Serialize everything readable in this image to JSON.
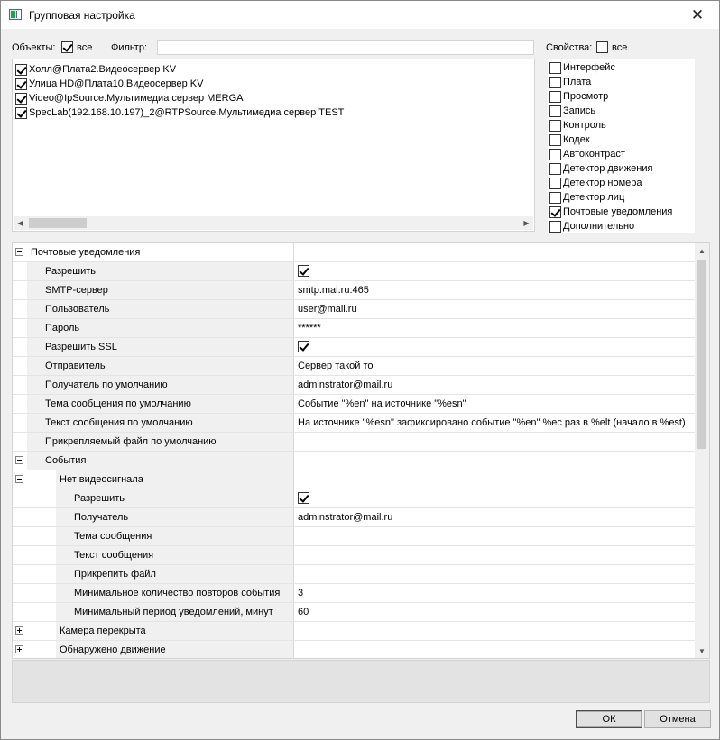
{
  "window": {
    "title": "Групповая настройка",
    "close_symbol": "✕"
  },
  "objects": {
    "label": "Объекты:",
    "all_label": "все",
    "all_checked": true,
    "filter_label": "Фильтр:",
    "filter_value": "",
    "items": [
      {
        "label": "Холл@Плата2.Видеосервер KV",
        "checked": true
      },
      {
        "label": "Улица HD@Плата10.Видеосервер KV",
        "checked": true
      },
      {
        "label": "Video@IpSource.Мультимедиа сервер MERGA",
        "checked": true
      },
      {
        "label": "SpecLab(192.168.10.197)_2@RTPSource.Мультимедиа сервер TEST",
        "checked": true
      }
    ],
    "scroll_left": "◀",
    "scroll_right": "▶"
  },
  "properties": {
    "label": "Свойства:",
    "all_label": "все",
    "all_checked": false,
    "items": [
      {
        "label": "Интерфейс",
        "checked": false
      },
      {
        "label": "Плата",
        "checked": false
      },
      {
        "label": "Просмотр",
        "checked": false
      },
      {
        "label": "Запись",
        "checked": false
      },
      {
        "label": "Контроль",
        "checked": false
      },
      {
        "label": "Кодек",
        "checked": false
      },
      {
        "label": "Автоконтраст",
        "checked": false
      },
      {
        "label": "Детектор движения",
        "checked": false
      },
      {
        "label": "Детектор номера",
        "checked": false
      },
      {
        "label": "Детектор лиц",
        "checked": false
      },
      {
        "label": "Почтовые уведомления",
        "checked": true
      },
      {
        "label": "Дополнительно",
        "checked": false
      }
    ]
  },
  "grid": {
    "rows": [
      {
        "name": "Почтовые уведомления",
        "value": "",
        "level": 0,
        "category": true,
        "expander": "minus"
      },
      {
        "name": "Разрешить",
        "value": "",
        "level": 1,
        "checkbox": true,
        "checked": true
      },
      {
        "name": "SMTP-сервер",
        "value": "smtp.mai.ru:465",
        "level": 1
      },
      {
        "name": "Пользователь",
        "value": "user@mail.ru",
        "level": 1
      },
      {
        "name": "Пароль",
        "value": "******",
        "level": 1
      },
      {
        "name": "Разрешить SSL",
        "value": "",
        "level": 1,
        "checkbox": true,
        "checked": true
      },
      {
        "name": "Отправитель",
        "value": "Сервер такой то",
        "level": 1
      },
      {
        "name": "Получатель по умолчанию",
        "value": "adminstrator@mail.ru",
        "level": 1
      },
      {
        "name": "Тема сообщения по умолчанию",
        "value": "Событие \"%en\" на источнике \"%esn\"",
        "level": 1
      },
      {
        "name": "Текст сообщения по умолчанию",
        "value": "На источнике \"%esn\" зафиксировано событие \"%en\" %ec раз в %elt (начало в %est)",
        "level": 1
      },
      {
        "name": "Прикрепляемый файл по умолчанию",
        "value": "",
        "level": 1
      },
      {
        "name": "События",
        "value": "",
        "level": 1,
        "category": true,
        "expander": "minus"
      },
      {
        "name": "Нет видеосигнала",
        "value": "",
        "level": 2,
        "category": true,
        "expander": "minus"
      },
      {
        "name": "Разрешить",
        "value": "",
        "level": 3,
        "checkbox": true,
        "checked": true
      },
      {
        "name": "Получатель",
        "value": "adminstrator@mail.ru",
        "level": 3
      },
      {
        "name": "Тема сообщения",
        "value": "",
        "level": 3
      },
      {
        "name": "Текст сообщения",
        "value": "",
        "level": 3
      },
      {
        "name": "Прикрепить файл",
        "value": "",
        "level": 3
      },
      {
        "name": "Минимальное количество повторов события",
        "value": "3",
        "level": 3
      },
      {
        "name": "Минимальный период уведомлений, минут",
        "value": "60",
        "level": 3
      },
      {
        "name": "Камера перекрыта",
        "value": "",
        "level": 2,
        "category": true,
        "expander": "plus"
      },
      {
        "name": "Обнаружено движение",
        "value": "",
        "level": 2,
        "category": true,
        "expander": "plus"
      }
    ],
    "scroll_up": "▲",
    "scroll_down": "▼"
  },
  "buttons": {
    "ok": "ОК",
    "cancel": "Отмена"
  }
}
